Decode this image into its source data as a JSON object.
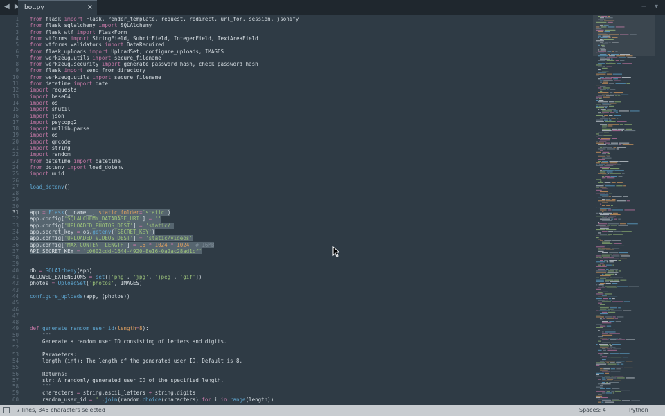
{
  "tab": {
    "title": "bot.py",
    "close": "×",
    "nav": "◀ ▶",
    "right_icons": "+ ▾"
  },
  "status": {
    "selection": "7 lines, 345 characters selected",
    "spaces": "Spaces: 4",
    "language": "Python"
  },
  "editor": {
    "current_line": 31,
    "lines": [
      [
        [
          "kw",
          "from"
        ],
        [
          "t",
          " flask "
        ],
        [
          "kw",
          "import"
        ],
        [
          "t",
          " Flask, render_template, request, redirect, url_for, session, jsonify"
        ]
      ],
      [
        [
          "kw",
          "from"
        ],
        [
          "t",
          " flask_sqlalchemy "
        ],
        [
          "kw",
          "import"
        ],
        [
          "t",
          " SQLAlchemy"
        ]
      ],
      [
        [
          "kw",
          "from"
        ],
        [
          "t",
          " flask_wtf "
        ],
        [
          "kw",
          "import"
        ],
        [
          "t",
          " FlaskForm"
        ]
      ],
      [
        [
          "kw",
          "from"
        ],
        [
          "t",
          " wtforms "
        ],
        [
          "kw",
          "import"
        ],
        [
          "t",
          " StringField, SubmitField, IntegerField, TextAreaField"
        ]
      ],
      [
        [
          "kw",
          "from"
        ],
        [
          "t",
          " wtforms.validators "
        ],
        [
          "kw",
          "import"
        ],
        [
          "t",
          " DataRequired"
        ]
      ],
      [
        [
          "kw",
          "from"
        ],
        [
          "t",
          " flask_uploads "
        ],
        [
          "kw",
          "import"
        ],
        [
          "t",
          " UploadSet, configure_uploads, IMAGES"
        ]
      ],
      [
        [
          "kw",
          "from"
        ],
        [
          "t",
          " werkzeug.utils "
        ],
        [
          "kw",
          "import"
        ],
        [
          "t",
          " secure_filename"
        ]
      ],
      [
        [
          "kw",
          "from"
        ],
        [
          "t",
          " werkzeug.security "
        ],
        [
          "kw",
          "import"
        ],
        [
          "t",
          " generate_password_hash, check_password_hash"
        ]
      ],
      [
        [
          "kw",
          "from"
        ],
        [
          "t",
          " flask "
        ],
        [
          "kw",
          "import"
        ],
        [
          "t",
          " send_from_directory"
        ]
      ],
      [
        [
          "kw",
          "from"
        ],
        [
          "t",
          " werkzeug.utils "
        ],
        [
          "kw",
          "import"
        ],
        [
          "t",
          " secure_filename"
        ]
      ],
      [
        [
          "kw",
          "from"
        ],
        [
          "t",
          " datetime "
        ],
        [
          "kw",
          "import"
        ],
        [
          "t",
          " date"
        ]
      ],
      [
        [
          "kw",
          "import"
        ],
        [
          "t",
          " requests"
        ]
      ],
      [
        [
          "kw",
          "import"
        ],
        [
          "t",
          " base64"
        ]
      ],
      [
        [
          "kw",
          "import"
        ],
        [
          "t",
          " os"
        ]
      ],
      [
        [
          "kw",
          "import"
        ],
        [
          "t",
          " shutil"
        ]
      ],
      [
        [
          "kw",
          "import"
        ],
        [
          "t",
          " json"
        ]
      ],
      [
        [
          "kw",
          "import"
        ],
        [
          "t",
          " psycopg2"
        ]
      ],
      [
        [
          "kw",
          "import"
        ],
        [
          "t",
          " urllib.parse"
        ]
      ],
      [
        [
          "kw",
          "import"
        ],
        [
          "t",
          " os"
        ]
      ],
      [
        [
          "kw",
          "import"
        ],
        [
          "t",
          " qrcode"
        ]
      ],
      [
        [
          "kw",
          "import"
        ],
        [
          "t",
          " string"
        ]
      ],
      [
        [
          "kw",
          "import"
        ],
        [
          "t",
          " random"
        ]
      ],
      [
        [
          "kw",
          "from"
        ],
        [
          "t",
          " datetime "
        ],
        [
          "kw",
          "import"
        ],
        [
          "t",
          " datetime"
        ]
      ],
      [
        [
          "kw",
          "from"
        ],
        [
          "t",
          " dotenv "
        ],
        [
          "kw",
          "import"
        ],
        [
          "t",
          " load_dotenv"
        ]
      ],
      [
        [
          "kw",
          "import"
        ],
        [
          "t",
          " uuid"
        ]
      ],
      [],
      [
        [
          "fn",
          "load_dotenv"
        ],
        [
          "t",
          "()"
        ]
      ],
      [],
      [],
      [],
      [
        [
          "t",
          "app "
        ],
        [
          "kw",
          "="
        ],
        [
          "t",
          " "
        ],
        [
          "fn",
          "Flask"
        ],
        [
          "t",
          "(__name__, "
        ],
        [
          "pa",
          "static_folder"
        ],
        [
          "kw",
          "="
        ],
        [
          "st",
          "'static'"
        ],
        [
          "t",
          ")"
        ]
      ],
      [
        [
          "t",
          "app.config["
        ],
        [
          "st",
          "'SQLALCHEMY_DATABASE_URI'"
        ],
        [
          "t",
          "] "
        ],
        [
          "kw",
          "="
        ],
        [
          "t",
          " "
        ],
        [
          "st",
          "''"
        ]
      ],
      [
        [
          "t",
          "app.config["
        ],
        [
          "st",
          "'UPLOADED_PHOTOS_DEST'"
        ],
        [
          "t",
          "] "
        ],
        [
          "kw",
          "="
        ],
        [
          "t",
          " "
        ],
        [
          "st",
          "'static/'"
        ]
      ],
      [
        [
          "t",
          "app.secret_key "
        ],
        [
          "kw",
          "="
        ],
        [
          "t",
          " os."
        ],
        [
          "fn",
          "getenv"
        ],
        [
          "t",
          "("
        ],
        [
          "st",
          "'SECRET_KEY'"
        ],
        [
          "t",
          ")"
        ]
      ],
      [
        [
          "t",
          "app.config["
        ],
        [
          "st",
          "'UPLOADED_VIDEOS_DEST'"
        ],
        [
          "t",
          "] "
        ],
        [
          "kw",
          "="
        ],
        [
          "t",
          " "
        ],
        [
          "st",
          "'static/videos'"
        ]
      ],
      [
        [
          "t",
          "app.config["
        ],
        [
          "st",
          "'MAX_CONTENT_LENGTH'"
        ],
        [
          "t",
          "] "
        ],
        [
          "kw",
          "="
        ],
        [
          "t",
          " "
        ],
        [
          "nm",
          "16"
        ],
        [
          "t",
          " "
        ],
        [
          "kw",
          "*"
        ],
        [
          "t",
          " "
        ],
        [
          "nm",
          "1024"
        ],
        [
          "t",
          " "
        ],
        [
          "kw",
          "*"
        ],
        [
          "t",
          " "
        ],
        [
          "nm",
          "1024"
        ],
        [
          "t",
          "  "
        ],
        [
          "cm",
          "# 16MB"
        ]
      ],
      [
        [
          "t",
          "API_SECRET_KEY "
        ],
        [
          "kw",
          "="
        ],
        [
          "t",
          " "
        ],
        [
          "st",
          "'c0602cdd-1644-4920-8e16-0a2ac28ad1cf'"
        ]
      ],
      [],
      [],
      [
        [
          "t",
          "db "
        ],
        [
          "kw",
          "="
        ],
        [
          "t",
          " "
        ],
        [
          "fn",
          "SQLAlchemy"
        ],
        [
          "t",
          "(app)"
        ]
      ],
      [
        [
          "t",
          "ALLOWED_EXTENSIONS "
        ],
        [
          "kw",
          "="
        ],
        [
          "t",
          " "
        ],
        [
          "fn",
          "set"
        ],
        [
          "t",
          "(["
        ],
        [
          "st",
          "'png'"
        ],
        [
          "t",
          ", "
        ],
        [
          "st",
          "'jpg'"
        ],
        [
          "t",
          ", "
        ],
        [
          "st",
          "'jpeg'"
        ],
        [
          "t",
          ", "
        ],
        [
          "st",
          "'gif'"
        ],
        [
          "t",
          "])"
        ]
      ],
      [
        [
          "t",
          "photos "
        ],
        [
          "kw",
          "="
        ],
        [
          "t",
          " "
        ],
        [
          "fn",
          "UploadSet"
        ],
        [
          "t",
          "("
        ],
        [
          "st",
          "'photos'"
        ],
        [
          "t",
          ", IMAGES)"
        ]
      ],
      [],
      [
        [
          "fn",
          "configure_uploads"
        ],
        [
          "t",
          "(app, (photos))"
        ]
      ],
      [],
      [],
      [],
      [],
      [
        [
          "kw",
          "def"
        ],
        [
          "t",
          " "
        ],
        [
          "fn",
          "generate_random_user_id"
        ],
        [
          "t",
          "("
        ],
        [
          "pa",
          "length"
        ],
        [
          "kw",
          "="
        ],
        [
          "nm",
          "8"
        ],
        [
          "t",
          "):"
        ]
      ],
      [
        [
          "cm",
          "    \"\"\""
        ]
      ],
      [
        [
          "t",
          "    Generate a random user ID consisting of letters and digits."
        ]
      ],
      [],
      [
        [
          "t",
          "    Parameters:"
        ]
      ],
      [
        [
          "t",
          "    length (int): The length of the generated user ID. Default is 8."
        ]
      ],
      [],
      [
        [
          "t",
          "    Returns:"
        ]
      ],
      [
        [
          "t",
          "    str: A randomly generated user ID of the specified length."
        ]
      ],
      [
        [
          "cm",
          "    \"\"\""
        ]
      ],
      [
        [
          "t",
          "    characters "
        ],
        [
          "kw",
          "="
        ],
        [
          "t",
          " string.ascii_letters "
        ],
        [
          "kw",
          "+"
        ],
        [
          "t",
          " string.digits"
        ]
      ],
      [
        [
          "t",
          "    random_user_id "
        ],
        [
          "kw",
          "="
        ],
        [
          "t",
          " "
        ],
        [
          "st",
          "''"
        ],
        [
          "t",
          "."
        ],
        [
          "fn",
          "join"
        ],
        [
          "t",
          "(random."
        ],
        [
          "fn",
          "choice"
        ],
        [
          "t",
          "(characters) "
        ],
        [
          "kw",
          "for"
        ],
        [
          "t",
          " i "
        ],
        [
          "kw",
          "in"
        ],
        [
          "t",
          " "
        ],
        [
          "fn",
          "range"
        ],
        [
          "t",
          "(length))"
        ]
      ]
    ],
    "selection": {
      "from": 31,
      "to": 37
    }
  }
}
